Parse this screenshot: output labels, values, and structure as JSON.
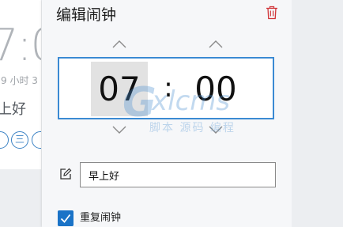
{
  "background_card": {
    "time_fragment": "7:0",
    "remaining_fragment": "9 小时 3",
    "name_fragment": "上好",
    "day_fragments": [
      "",
      "三",
      ""
    ]
  },
  "panel": {
    "title": "编辑闹钟",
    "delete_icon": "trash-icon"
  },
  "time_picker": {
    "hour": "07",
    "separator": ":",
    "minute": "00"
  },
  "alarm_name": {
    "value": "早上好",
    "icon": "edit-icon"
  },
  "repeat": {
    "label": "重复闹钟",
    "checked": true
  },
  "watermark": {
    "letter": "G",
    "word": "xlcms",
    "subtitle": "脚本 源码 编程"
  },
  "colors": {
    "accent": "#3b8ad3",
    "check": "#1a73c7",
    "delete": "#d13438"
  }
}
